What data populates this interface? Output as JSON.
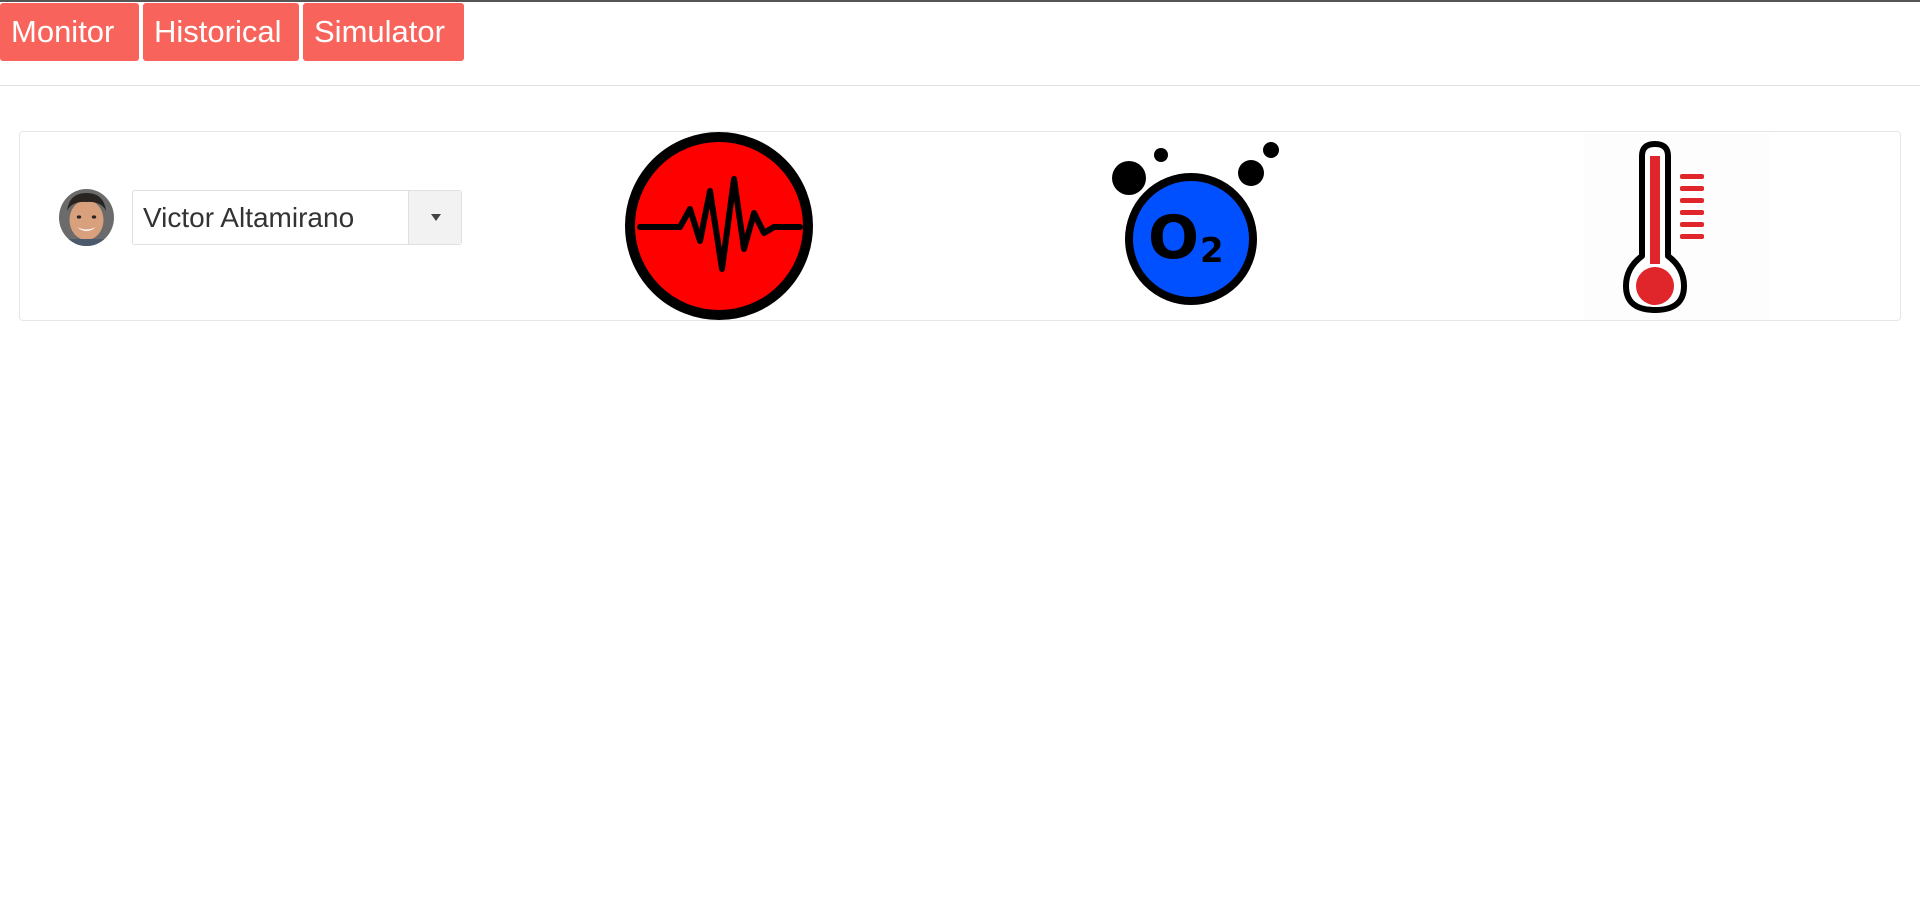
{
  "nav": {
    "buttons": [
      {
        "label": "Monitor"
      },
      {
        "label": "Historical"
      },
      {
        "label": "Simulator"
      }
    ],
    "button_color": "#f8645b"
  },
  "patient_selector": {
    "selected": "Victor Altamirano",
    "avatar": "patient-photo"
  },
  "vitals": {
    "icons": [
      "heart-rate-icon",
      "oxygen-saturation-icon",
      "temperature-icon"
    ],
    "colors": {
      "heart": "#ff0000",
      "oxygen": "#0050ff",
      "temperature": "#e0262a"
    }
  }
}
